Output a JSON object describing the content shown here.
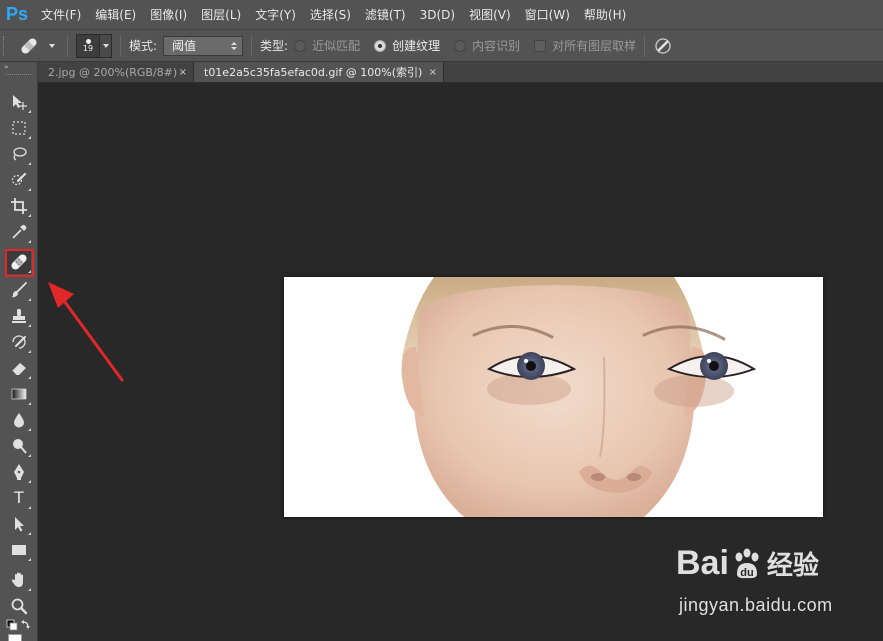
{
  "app": {
    "logo": "Ps",
    "accent_color": "#31a8ff",
    "highlight_color": "#e02828"
  },
  "menubar": {
    "items": [
      {
        "label": "文件(F)"
      },
      {
        "label": "编辑(E)"
      },
      {
        "label": "图像(I)"
      },
      {
        "label": "图层(L)"
      },
      {
        "label": "文字(Y)"
      },
      {
        "label": "选择(S)"
      },
      {
        "label": "滤镜(T)"
      },
      {
        "label": "3D(D)"
      },
      {
        "label": "视图(V)"
      },
      {
        "label": "窗口(W)"
      },
      {
        "label": "帮助(H)"
      }
    ]
  },
  "options": {
    "tool_preset_icon": "healing-brush-icon",
    "brush_size": "19",
    "mode_label": "模式:",
    "mode_value": "阈值",
    "type_label": "类型:",
    "type_options": [
      {
        "label": "近似匹配",
        "checked": false
      },
      {
        "label": "创建纹理",
        "checked": true
      },
      {
        "label": "内容识别",
        "checked": false
      }
    ],
    "sample_all_layers": {
      "label": "对所有图层取样",
      "checked": false
    },
    "pressure_icon": "pressure-brush-icon"
  },
  "tabs": [
    {
      "label": "2.jpg @ 200%(RGB/8#)",
      "close": "×",
      "active": false
    },
    {
      "label": "t01e2a5c35fa5efac0d.gif @ 100%(索引)",
      "close": "×",
      "active": true
    }
  ],
  "toolbox": {
    "collapse": "››",
    "tools": [
      {
        "name": "move-tool",
        "icon": "move-icon"
      },
      {
        "name": "marquee-tool",
        "icon": "marquee-icon"
      },
      {
        "name": "lasso-tool",
        "icon": "lasso-icon"
      },
      {
        "name": "quick-selection-tool",
        "icon": "quick-selection-icon"
      },
      {
        "name": "crop-tool",
        "icon": "crop-icon"
      },
      {
        "name": "eyedropper-tool",
        "icon": "eyedropper-icon"
      },
      {
        "name": "spot-healing-tool",
        "icon": "bandage-icon",
        "selected": true
      },
      {
        "name": "brush-tool",
        "icon": "brush-icon"
      },
      {
        "name": "clone-stamp-tool",
        "icon": "stamp-icon"
      },
      {
        "name": "history-brush-tool",
        "icon": "history-brush-icon"
      },
      {
        "name": "eraser-tool",
        "icon": "eraser-icon"
      },
      {
        "name": "gradient-tool",
        "icon": "gradient-icon"
      },
      {
        "name": "blur-tool",
        "icon": "drop-icon"
      },
      {
        "name": "dodge-tool",
        "icon": "dodge-icon"
      },
      {
        "name": "pen-tool",
        "icon": "pen-icon"
      },
      {
        "name": "type-tool",
        "icon": "type-icon",
        "glyph": "T"
      },
      {
        "name": "path-selection-tool",
        "icon": "arrow-icon"
      },
      {
        "name": "shape-tool",
        "icon": "rectangle-icon"
      },
      {
        "name": "hand-tool",
        "icon": "hand-icon"
      },
      {
        "name": "zoom-tool",
        "icon": "zoom-icon"
      }
    ]
  },
  "document": {
    "image_description_icon": "face-photo-icon"
  },
  "watermark": {
    "logo_left": "Bai",
    "logo_right": "du",
    "logo_cn": "经验",
    "url": "jingyan.baidu.com"
  }
}
